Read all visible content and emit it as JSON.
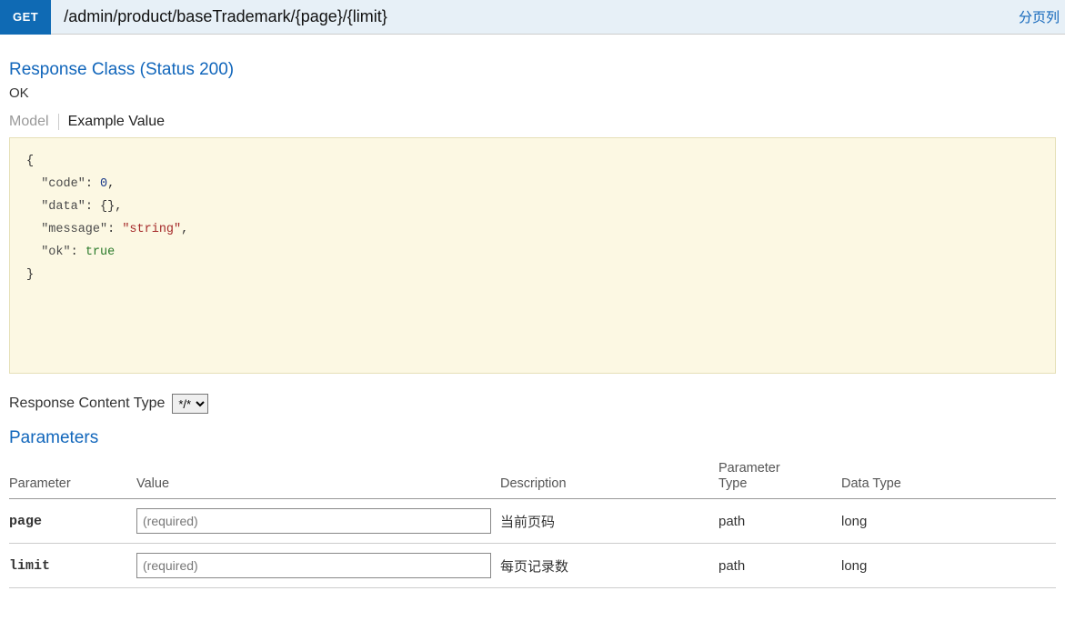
{
  "header": {
    "method": "GET",
    "path": "/admin/product/baseTrademark/{page}/{limit}",
    "right_link": "分页列"
  },
  "response": {
    "title": "Response Class (Status 200)",
    "status_text": "OK",
    "tab_model": "Model",
    "tab_example": "Example Value",
    "json": {
      "k_code": "\"code\"",
      "v_code": "0",
      "k_data": "\"data\"",
      "v_data": "{}",
      "k_message": "\"message\"",
      "v_message": "\"string\"",
      "k_ok": "\"ok\"",
      "v_ok": "true"
    }
  },
  "content_type": {
    "label": "Response Content Type",
    "selected": "*/*"
  },
  "params": {
    "title": "Parameters",
    "headers": {
      "parameter": "Parameter",
      "value": "Value",
      "description": "Description",
      "ptype_l1": "Parameter",
      "ptype_l2": "Type",
      "dtype": "Data Type"
    },
    "rows": [
      {
        "name": "page",
        "placeholder": "(required)",
        "desc": "当前页码",
        "ptype": "path",
        "dtype": "long"
      },
      {
        "name": "limit",
        "placeholder": "(required)",
        "desc": "每页记录数",
        "ptype": "path",
        "dtype": "long"
      }
    ]
  }
}
